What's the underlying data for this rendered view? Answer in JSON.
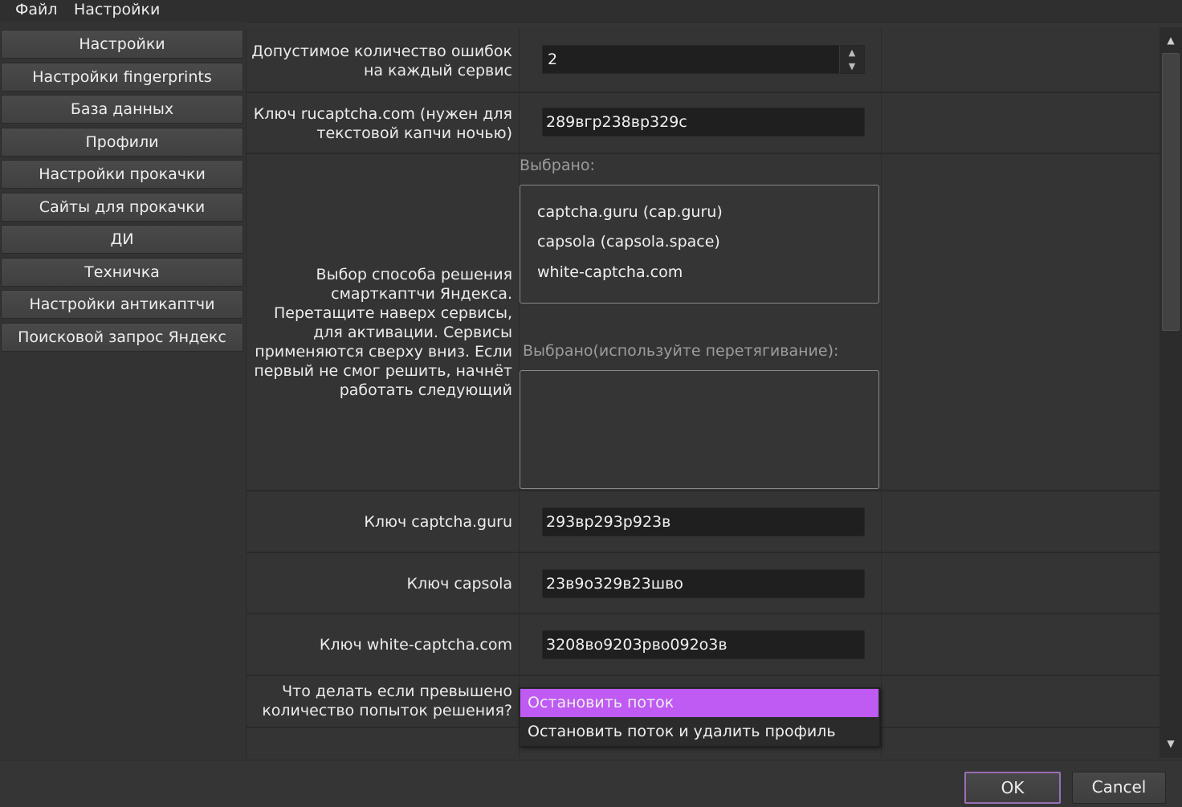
{
  "menu": [
    "Файл",
    "Настройки"
  ],
  "nav": [
    "Настройки",
    "Настройки fingerprints",
    "База данных",
    "Профили",
    "Настройки прокачки",
    "Сайты для прокачки",
    "ДИ",
    "Техничка",
    "Настройки антикаптчи",
    "Поисковой запрос Яндекс"
  ],
  "form": {
    "max_errors": {
      "label": "Допустимое количество ошибок на каждый сервис",
      "value": "2"
    },
    "rucaptcha": {
      "label": "Ключ rucaptcha.com (нужен для текстовой капчи ночью)",
      "value": "289вгр238вр329с"
    },
    "smartcaptcha": {
      "label": "Выбор способа решения смарткаптчи Яндекса. Перетащите наверх сервисы, для активации. Сервисы применяются сверху вниз. Если первый не смог решить, начнёт работать следующий",
      "available_caption": "Выбрано:",
      "available_items": [
        "captcha.guru (cap.guru)",
        "capsola (capsola.space)",
        "white-captcha.com"
      ],
      "selected_caption": "Выбрано(используйте перетягивание):",
      "selected_items": []
    },
    "captcha_guru": {
      "label": "Ключ captcha.guru",
      "value": "293вр293р923в"
    },
    "capsola": {
      "label": "Ключ capsola",
      "value": "23в9о329в23шво"
    },
    "white_captcha": {
      "label": "Ключ white-captcha.com",
      "value": "3208во9203рво092о3в"
    },
    "exceeded": {
      "label": "Что делать если превышено количество попыток решения?",
      "options": [
        "Остановить поток",
        "Остановить поток и удалить профиль"
      ],
      "selected": "Остановить поток"
    }
  },
  "buttons": {
    "ok": "OK",
    "cancel": "Cancel"
  },
  "colors": {
    "highlight": "#bf5af2",
    "background": "#353535",
    "field": "#1f1f1f",
    "ok_border": "#9a6fb5"
  },
  "icons": {
    "spin_up": "spin-up-icon",
    "spin_down": "spin-down-icon",
    "scroll_up": "scroll-up-icon",
    "scroll_down": "scroll-down-icon"
  }
}
